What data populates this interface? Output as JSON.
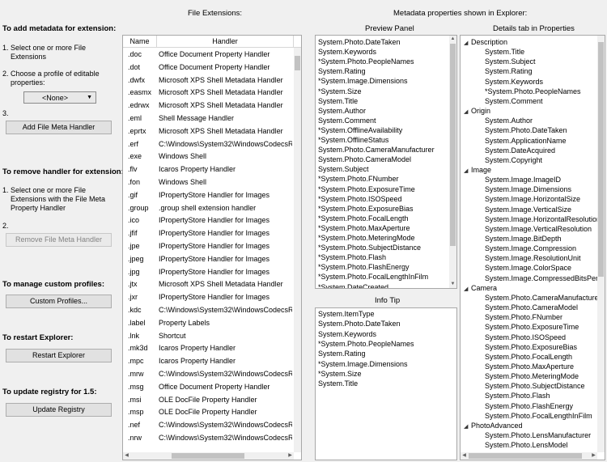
{
  "headers": {
    "file_extensions": "File Extensions:",
    "metadata_properties": "Metadata properties shown in Explorer:",
    "preview_panel": "Preview Panel",
    "details_tab": "Details tab in Properties",
    "info_tip": "Info Tip"
  },
  "left": {
    "add_title": "To add metadata for extension:",
    "add_step1_num": "1.",
    "add_step1": "Select one or more File Extensions",
    "add_step2_num": "2.",
    "add_step2": "Choose a profile of editable properties:",
    "profile_value": "<None>",
    "add_step3_num": "3.",
    "add_button": "Add File Meta Handler",
    "remove_title": "To remove handler for extension:",
    "remove_step1_num": "1.",
    "remove_step1": "Select one or more File Extensions with the File Meta Property Handler",
    "remove_step2_num": "2.",
    "remove_button": "Remove File Meta Handler",
    "profiles_title": "To manage custom profiles:",
    "profiles_button": "Custom Profiles...",
    "restart_title": "To restart Explorer:",
    "restart_button": "Restart Explorer",
    "registry_title": "To update registry for 1.5:",
    "registry_button": "Update Registry"
  },
  "grid": {
    "col_name": "Name",
    "col_handler": "Handler",
    "rows": [
      {
        "name": ".doc",
        "handler": "Office Document Property Handler"
      },
      {
        "name": ".dot",
        "handler": "Office Document Property Handler"
      },
      {
        "name": ".dwfx",
        "handler": "Microsoft XPS Shell Metadata Handler"
      },
      {
        "name": ".easmx",
        "handler": "Microsoft XPS Shell Metadata Handler"
      },
      {
        "name": ".edrwx",
        "handler": "Microsoft XPS Shell Metadata Handler"
      },
      {
        "name": ".eml",
        "handler": "Shell Message Handler"
      },
      {
        "name": ".eprtx",
        "handler": "Microsoft XPS Shell Metadata Handler"
      },
      {
        "name": ".erf",
        "handler": "C:\\Windows\\System32\\WindowsCodecsR"
      },
      {
        "name": ".exe",
        "handler": "Windows Shell"
      },
      {
        "name": ".flv",
        "handler": "Icaros Property Handler"
      },
      {
        "name": ".fon",
        "handler": "Windows Shell"
      },
      {
        "name": ".gif",
        "handler": "IPropertyStore Handler for Images"
      },
      {
        "name": ".group",
        "handler": ".group shell extension handler"
      },
      {
        "name": ".ico",
        "handler": "IPropertyStore Handler for Images"
      },
      {
        "name": ".jfif",
        "handler": "IPropertyStore Handler for Images"
      },
      {
        "name": ".jpe",
        "handler": "IPropertyStore Handler for Images"
      },
      {
        "name": ".jpeg",
        "handler": "IPropertyStore Handler for Images"
      },
      {
        "name": ".jpg",
        "handler": "IPropertyStore Handler for Images"
      },
      {
        "name": ".jtx",
        "handler": "Microsoft XPS Shell Metadata Handler"
      },
      {
        "name": ".jxr",
        "handler": "IPropertyStore Handler for Images"
      },
      {
        "name": ".kdc",
        "handler": "C:\\Windows\\System32\\WindowsCodecsR"
      },
      {
        "name": ".label",
        "handler": "Property Labels"
      },
      {
        "name": ".lnk",
        "handler": "Shortcut"
      },
      {
        "name": ".mk3d",
        "handler": "Icaros Property Handler"
      },
      {
        "name": ".mpc",
        "handler": "Icaros Property Handler"
      },
      {
        "name": ".mrw",
        "handler": "C:\\Windows\\System32\\WindowsCodecsR"
      },
      {
        "name": ".msg",
        "handler": "Office Document Property Handler"
      },
      {
        "name": ".msi",
        "handler": "OLE DocFile Property Handler"
      },
      {
        "name": ".msp",
        "handler": "OLE DocFile Property Handler"
      },
      {
        "name": ".nef",
        "handler": "C:\\Windows\\System32\\WindowsCodecsR"
      },
      {
        "name": ".nrw",
        "handler": "C:\\Windows\\System32\\WindowsCodecsR"
      }
    ]
  },
  "preview_items": [
    "System.Photo.DateTaken",
    "System.Keywords",
    "*System.Photo.PeopleNames",
    "System.Rating",
    "*System.Image.Dimensions",
    "*System.Size",
    "System.Title",
    "System.Author",
    "System.Comment",
    "*System.OfflineAvailability",
    "*System.OfflineStatus",
    "System.Photo.CameraManufacturer",
    "System.Photo.CameraModel",
    "System.Subject",
    "*System.Photo.FNumber",
    "*System.Photo.ExposureTime",
    "*System.Photo.ISOSpeed",
    "*System.Photo.ExposureBias",
    "*System.Photo.FocalLength",
    "*System.Photo.MaxAperture",
    "*System.Photo.MeteringMode",
    "*System.Photo.SubjectDistance",
    "*System.Photo.Flash",
    "*System.Photo.FlashEnergy",
    "*System.Photo.FocalLengthInFilm",
    "*System.DateCreated"
  ],
  "infotip_items": [
    "System.ItemType",
    "System.Photo.DateTaken",
    "System.Keywords",
    "*System.Photo.PeopleNames",
    "System.Rating",
    "*System.Image.Dimensions",
    "*System.Size",
    "System.Title"
  ],
  "details_tree": [
    {
      "label": "Description",
      "group": true
    },
    {
      "label": "System.Title"
    },
    {
      "label": "System.Subject"
    },
    {
      "label": "System.Rating"
    },
    {
      "label": "System.Keywords"
    },
    {
      "label": "*System.Photo.PeopleNames"
    },
    {
      "label": "System.Comment"
    },
    {
      "label": "Origin",
      "group": true
    },
    {
      "label": "System.Author"
    },
    {
      "label": "System.Photo.DateTaken"
    },
    {
      "label": "System.ApplicationName"
    },
    {
      "label": "System.DateAcquired"
    },
    {
      "label": "System.Copyright"
    },
    {
      "label": "Image",
      "group": true
    },
    {
      "label": "System.Image.ImageID"
    },
    {
      "label": "System.Image.Dimensions"
    },
    {
      "label": "System.Image.HorizontalSize"
    },
    {
      "label": "System.Image.VerticalSize"
    },
    {
      "label": "System.Image.HorizontalResolution"
    },
    {
      "label": "System.Image.VerticalResolution"
    },
    {
      "label": "System.Image.BitDepth"
    },
    {
      "label": "System.Image.Compression"
    },
    {
      "label": "System.Image.ResolutionUnit"
    },
    {
      "label": "System.Image.ColorSpace"
    },
    {
      "label": "System.Image.CompressedBitsPerPixel"
    },
    {
      "label": "Camera",
      "group": true
    },
    {
      "label": "System.Photo.CameraManufacturer"
    },
    {
      "label": "System.Photo.CameraModel"
    },
    {
      "label": "System.Photo.FNumber"
    },
    {
      "label": "System.Photo.ExposureTime"
    },
    {
      "label": "System.Photo.ISOSpeed"
    },
    {
      "label": "System.Photo.ExposureBias"
    },
    {
      "label": "System.Photo.FocalLength"
    },
    {
      "label": "System.Photo.MaxAperture"
    },
    {
      "label": "System.Photo.MeteringMode"
    },
    {
      "label": "System.Photo.SubjectDistance"
    },
    {
      "label": "System.Photo.Flash"
    },
    {
      "label": "System.Photo.FlashEnergy"
    },
    {
      "label": "System.Photo.FocalLengthInFilm"
    },
    {
      "label": "PhotoAdvanced",
      "group": true
    },
    {
      "label": "System.Photo.LensManufacturer"
    },
    {
      "label": "System.Photo.LensModel"
    }
  ],
  "icons": {
    "combo_arrow": "chevron-down-icon",
    "tree_expanded": "triangle-expanded-icon",
    "scroll_up": "scroll-up-icon",
    "scroll_down": "scroll-down-icon"
  }
}
